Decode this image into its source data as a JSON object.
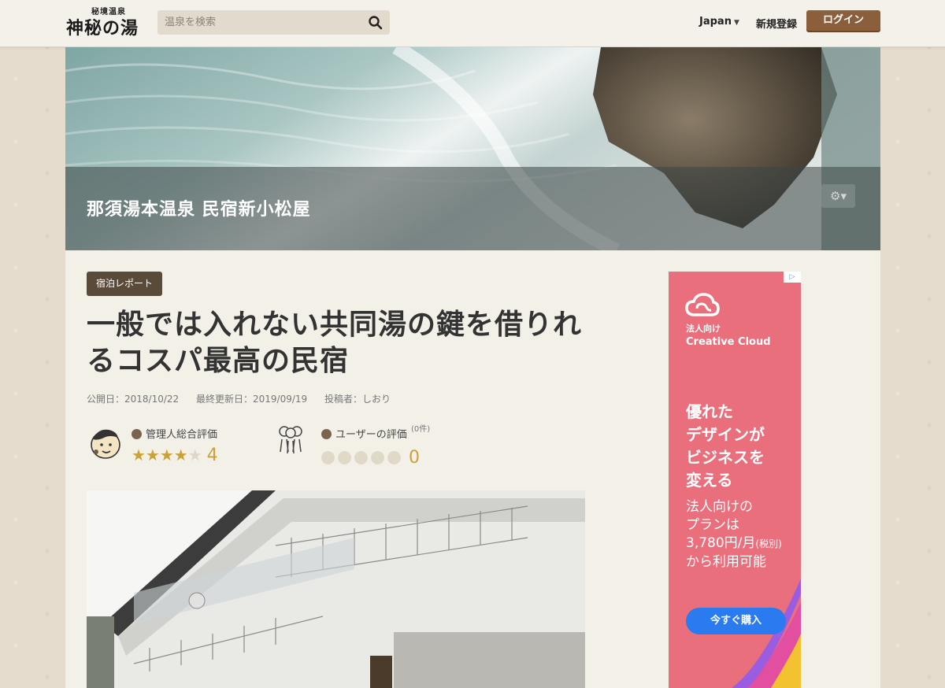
{
  "header": {
    "logo_small": "秘境温泉",
    "logo_big": "神秘の湯",
    "search_placeholder": "温泉を検索",
    "lang_label": "Japan",
    "register_label": "新規登録",
    "login_label": "ログイン"
  },
  "hero": {
    "title": "那須湯本温泉 民宿新小松屋",
    "settings_icon": "gear-icon"
  },
  "article": {
    "tag": "宿泊レポート",
    "title": "一般では入れない共同湯の鍵を借りれるコスパ最高の民宿",
    "published": "公開日：2018/10/22",
    "updated": "最終更新日：2019/09/19",
    "author": "投稿者：しおり"
  },
  "ratings": {
    "admin": {
      "label": "管理人総合評価",
      "stars_filled": "★★★★",
      "stars_empty": "★",
      "score": "4"
    },
    "user": {
      "label": "ユーザーの評価",
      "count": "(0件)",
      "score": "0"
    }
  },
  "ad": {
    "badge": "▷",
    "brand_line1": "法人向け",
    "brand_line2": "Creative Cloud",
    "headline_1": "優れた",
    "headline_2": "デザインが",
    "headline_3": "ビジネスを",
    "headline_4": "変える",
    "body_1": "法人向けの",
    "body_2": "プランは",
    "body_3": "3,780円/月",
    "body_3_small": "(税別)",
    "body_4": "から利用可能",
    "cta": "今すぐ購入"
  },
  "colors": {
    "login_button": "#8b5e3c",
    "tag_bg": "#5a4a3a",
    "star_gold": "#c9a23a",
    "ad_bg": "#ea6f7c",
    "ad_cta": "#2a7bef"
  }
}
